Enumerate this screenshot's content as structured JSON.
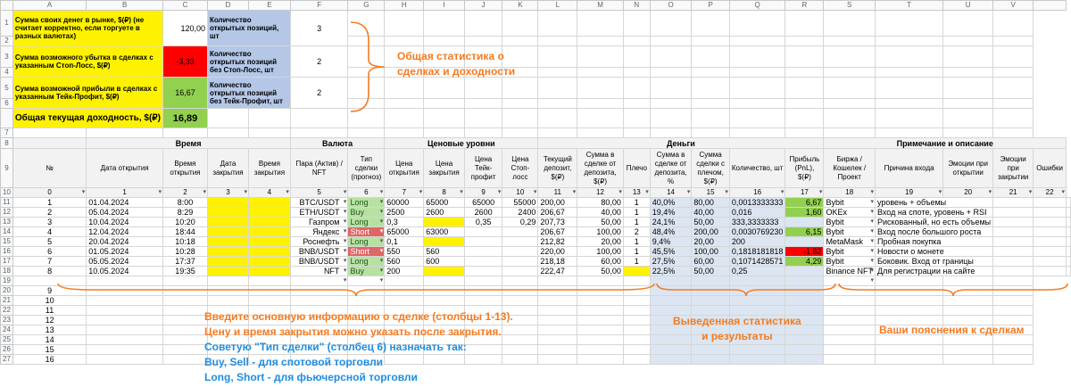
{
  "columns": [
    "A",
    "B",
    "C",
    "D",
    "E",
    "F",
    "G",
    "H",
    "I",
    "J",
    "K",
    "L",
    "M",
    "N",
    "O",
    "P",
    "Q",
    "R",
    "S",
    "T",
    "U",
    "V"
  ],
  "summary": {
    "own_money_label": "Сумма своих денег в рынке, $(₽) (не считает корректно, если торгуете в разных валютах)",
    "own_money_value": "120,00",
    "stop_loss_label": "Сумма возможного убытка в сделках с указанным Стоп-Лосс, $(₽)",
    "stop_loss_value": "-3,33",
    "take_profit_label": "Сумма возможной прибыли в сделках с указанным Тейк-Профит, $(₽)",
    "take_profit_value": "16,67",
    "total_label": "Общая текущая доходность, $(₽)",
    "total_value": "16,89",
    "open_positions_label": "Количество открытых позиций, шт",
    "open_positions_value": "3",
    "no_sl_label": "Количество открытых позиций без Стоп-Лосс, шт",
    "no_sl_value": "2",
    "no_tp_label": "Количество открытых позиций без Тейк-Профит, шт",
    "no_tp_value": "2"
  },
  "groups": {
    "time": "Время",
    "currency": "Валюта",
    "price": "Ценовые уровни",
    "money": "Деньги",
    "notes": "Примечание и описание"
  },
  "headers": [
    "№",
    "Дата открытия",
    "Время открытия",
    "Дата закрытия",
    "Время закрытия",
    "Пара (Актив) / NFT",
    "Тип сделки (прогноз)",
    "Цена открытия",
    "Цена закрытия",
    "Цена Тейк-профит",
    "Цена Стоп-лосс",
    "Текущий депозит, $(₽)",
    "Сумма в сделке от депозита, $(₽)",
    "Плечо",
    "Сумма в сделке от депозита, %",
    "Сумма сделки с плечом, $(₽)",
    "Количество, шт",
    "Прибыль (PnL), $(₽)",
    "Биржа / Кошелек / Проект",
    "Причина входа",
    "Эмоции при открытии",
    "Эмоции при закрытии",
    "Ошибки"
  ],
  "col_numbers": [
    "0",
    "1",
    "2",
    "3",
    "4",
    "5",
    "6",
    "7",
    "8",
    "9",
    "10",
    "11",
    "12",
    "13",
    "14",
    "15",
    "16",
    "17",
    "18",
    "19",
    "20",
    "21",
    "22"
  ],
  "trades": [
    {
      "n": "1",
      "date": "01.04.2024",
      "time": "8:00",
      "pair": "BTC/USDT",
      "type": "Long",
      "open": "60000",
      "close": "65000",
      "tp": "65000",
      "sl": "55000",
      "dep": "200,00",
      "sum": "80,00",
      "lev": "1",
      "pct": "40,0%",
      "lsum": "80,00",
      "qty": "0,0013333333",
      "pnl": "6,67",
      "pnlc": "grn",
      "ex": "Bybit",
      "reason": "уровень + объемы"
    },
    {
      "n": "2",
      "date": "05.04.2024",
      "time": "8:29",
      "pair": "ETH/USDT",
      "type": "Buy",
      "open": "2500",
      "close": "2600",
      "tp": "2600",
      "sl": "2400",
      "dep": "206,67",
      "sum": "40,00",
      "lev": "1",
      "pct": "19,4%",
      "lsum": "40,00",
      "qty": "0,016",
      "pnl": "1,60",
      "pnlc": "grn",
      "ex": "OKEx",
      "reason": "Вход на споте, уровень + RSI"
    },
    {
      "n": "3",
      "date": "10.04.2024",
      "time": "10:20",
      "pair": "Газпром",
      "type": "Long",
      "open": "0,3",
      "close": "",
      "tp": "0,35",
      "sl": "0,29",
      "dep": "207,73",
      "sum": "50,00",
      "lev": "1",
      "pct": "24,1%",
      "lsum": "50,00",
      "qty": "333,3333333",
      "pnl": "",
      "pnlc": "",
      "ex": "Bybit",
      "reason": "Рискованный, но есть объемы"
    },
    {
      "n": "4",
      "date": "12.04.2024",
      "time": "18:44",
      "pair": "Яндекс",
      "type": "Short",
      "open": "65000",
      "close": "63000",
      "tp": "",
      "sl": "",
      "dep": "206,67",
      "sum": "100,00",
      "lev": "2",
      "pct": "48,4%",
      "lsum": "200,00",
      "qty": "0,0030769230",
      "pnl": "6,15",
      "pnlc": "grn",
      "ex": "Bybit",
      "reason": "Вход после большого роста"
    },
    {
      "n": "5",
      "date": "20.04.2024",
      "time": "10:18",
      "pair": "Роснефть",
      "type": "Long",
      "open": "0,1",
      "close": "",
      "tp": "",
      "sl": "",
      "dep": "212,82",
      "sum": "20,00",
      "lev": "1",
      "pct": "9,4%",
      "lsum": "20,00",
      "qty": "200",
      "pnl": "",
      "pnlc": "",
      "ex": "MetaMask",
      "reason": "Пробная покупка"
    },
    {
      "n": "6",
      "date": "01.05.2024",
      "time": "10:28",
      "pair": "BNB/USDT",
      "type": "Short",
      "open": "550",
      "close": "560",
      "tp": "",
      "sl": "",
      "dep": "220,00",
      "sum": "100,00",
      "lev": "1",
      "pct": "45,5%",
      "lsum": "100,00",
      "qty": "0,1818181818",
      "pnl": "-1,82",
      "pnlc": "red",
      "ex": "Bybit",
      "reason": "Новости о монете"
    },
    {
      "n": "7",
      "date": "05.05.2024",
      "time": "17:37",
      "pair": "BNB/USDT",
      "type": "Long",
      "open": "560",
      "close": "600",
      "tp": "",
      "sl": "",
      "dep": "218,18",
      "sum": "60,00",
      "lev": "1",
      "pct": "27,5%",
      "lsum": "60,00",
      "qty": "0,1071428571",
      "pnl": "4,29",
      "pnlc": "grn",
      "ex": "Bybit",
      "reason": "Боковик. Вход от границы"
    },
    {
      "n": "8",
      "date": "10.05.2024",
      "time": "19:35",
      "pair": "NFT",
      "type": "Buy",
      "open": "200",
      "close": "",
      "tp": "",
      "sl": "",
      "dep": "222,47",
      "sum": "50,00",
      "lev": "",
      "pct": "22,5%",
      "lsum": "50,00",
      "qty": "0,25",
      "pnl": "",
      "pnlc": "",
      "ex": "Binance NFT",
      "reason": "Для регистрации на сайте"
    }
  ],
  "empty_rows": [
    "9",
    "10",
    "11",
    "12",
    "13",
    "14",
    "15",
    "16"
  ],
  "annotations": {
    "stats": [
      "Общая статистика о",
      "сделках и доходности"
    ],
    "input1": "Введите основную информацию о сделке (столбцы 1-13).",
    "input2": "Цену и время закрытия можно указать после закрытия.",
    "advice1": "Советую \"Тип сделки\" (столбец 6) назначать так:",
    "advice2": "Buy, Sell - для спотовой торговли",
    "advice3": "Long, Short - для фьючерсной торговли",
    "results": [
      "Выведенная статистика",
      "и результаты"
    ],
    "notes": "Ваши пояснения к сделкам"
  }
}
